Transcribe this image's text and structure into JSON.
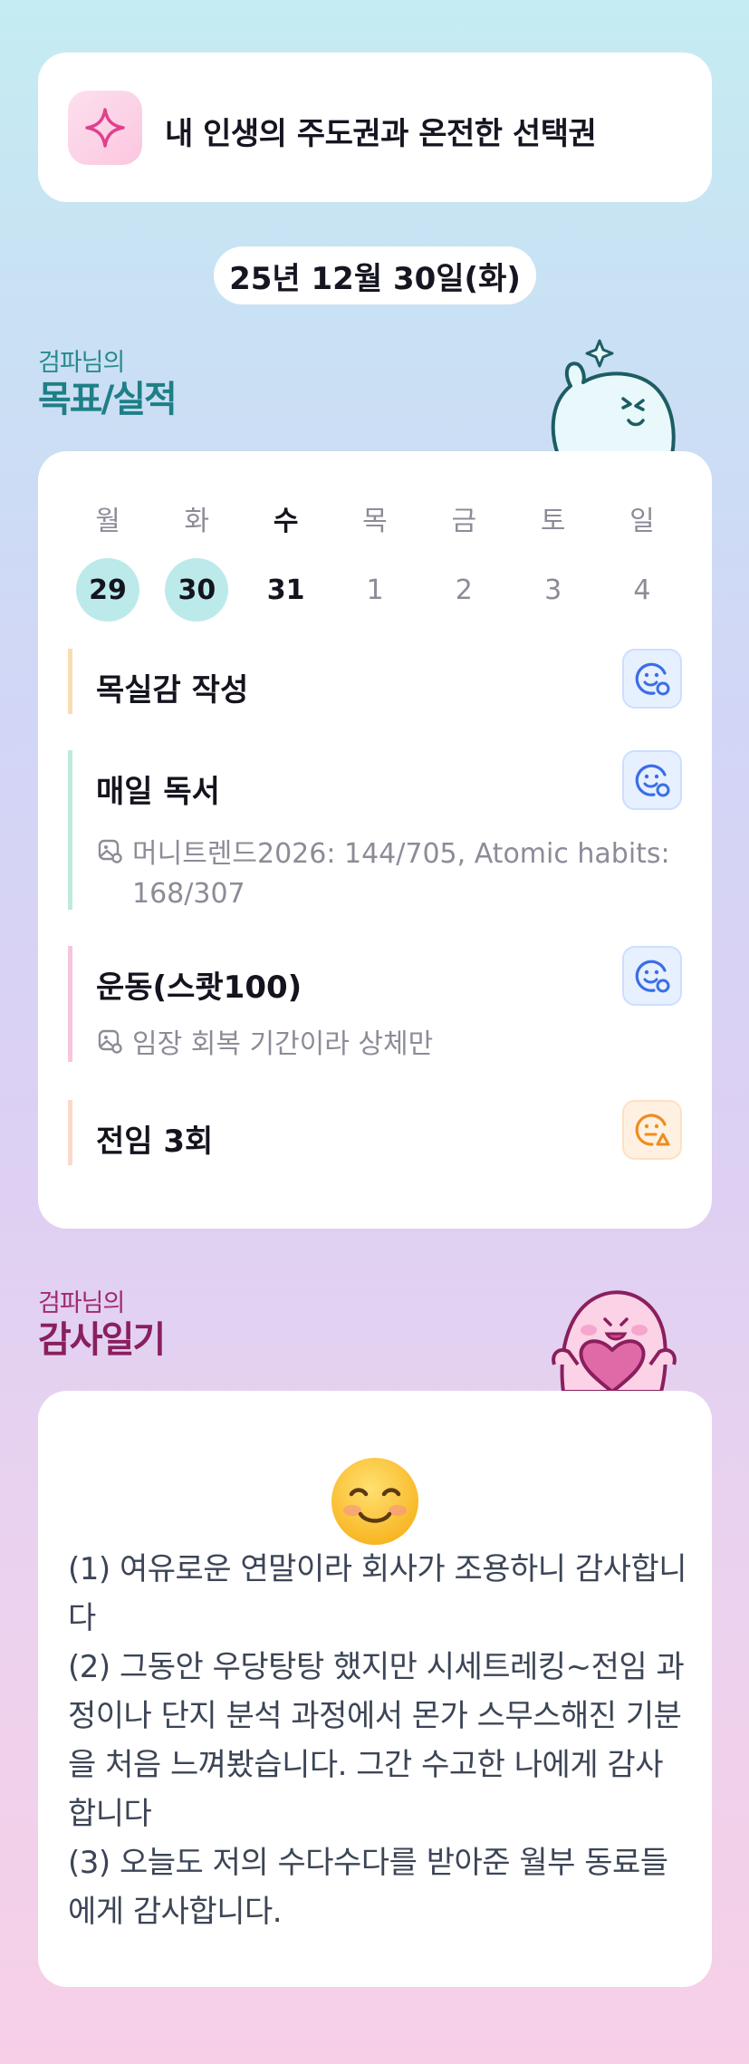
{
  "header": {
    "title": "내 인생의 주도권과 온전한 선택권",
    "icon": "sparkle-icon"
  },
  "date_label": "25년 12월 30일(화)",
  "goals_section": {
    "subtitle": "검파님의",
    "title": "목표/실적"
  },
  "week": {
    "days": [
      {
        "name": "월",
        "num": "29",
        "state": "done"
      },
      {
        "name": "화",
        "num": "30",
        "state": "done"
      },
      {
        "name": "수",
        "num": "31",
        "state": "today"
      },
      {
        "name": "목",
        "num": "1",
        "state": "future"
      },
      {
        "name": "금",
        "num": "2",
        "state": "future"
      },
      {
        "name": "토",
        "num": "3",
        "state": "future"
      },
      {
        "name": "일",
        "num": "4",
        "state": "future"
      }
    ]
  },
  "goals": [
    {
      "name": "목실감 작성",
      "note": "",
      "accent": "#f7dcb6",
      "status": "smile-blue"
    },
    {
      "name": "매일 독서",
      "note": "머니트렌드2026: 144/705, Atomic habits: 168/307",
      "accent": "#bfeadc",
      "status": "smile-blue"
    },
    {
      "name": "운동(스쾃100)",
      "note": "임장 회복 기간이라 상체만",
      "accent": "#f6c6dc",
      "status": "smile-blue"
    },
    {
      "name": "전임 3회",
      "note": "",
      "accent": "#fbd9c9",
      "status": "meh-orange"
    }
  ],
  "gratitude_section": {
    "subtitle": "검파님의",
    "title": "감사일기"
  },
  "gratitude": {
    "emoji": "smiling-face-icon",
    "lines": [
      "(1) 여유로운 연말이라 회사가 조용하니 감사합니다",
      "(2) 그동안 우당탕탕 했지만 시세트레킹~전임 과정이나 단지 분석 과정에서 몬가 스무스해진 기분을 처음 느껴봤습니다. 그간 수고한 나에게 감사합니다",
      "(3) 오늘도 저의 수다수다를 받아준 월부 동료들에게 감사합니다."
    ]
  },
  "colors": {
    "teal_title": "#1e7f86",
    "pink_title": "#8a1f5e",
    "done_day_bg": "#bceaea"
  }
}
